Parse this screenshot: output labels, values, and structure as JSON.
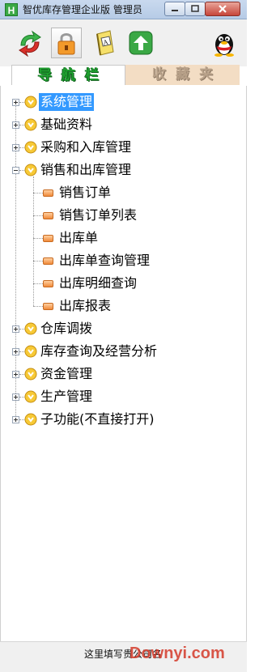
{
  "window": {
    "logo_letter": "H",
    "title": "智优库存管理企业版 管理员"
  },
  "toolbar": {
    "items": [
      {
        "icon": "refresh-arrows-icon"
      },
      {
        "icon": "lock-icon",
        "pressed": true
      },
      {
        "icon": "dictionary-book-icon"
      },
      {
        "icon": "upload-arrow-icon"
      }
    ],
    "right_icon": "qq-penguin-icon"
  },
  "tabs": [
    {
      "label": "导航栏",
      "active": true
    },
    {
      "label": "收藏夹",
      "active": false
    }
  ],
  "tree": {
    "nodes": [
      {
        "label": "系统管理",
        "expanded": false,
        "selected": true
      },
      {
        "label": "基础资料",
        "expanded": false
      },
      {
        "label": "采购和入库管理",
        "expanded": false
      },
      {
        "label": "销售和出库管理",
        "expanded": true,
        "children": [
          "销售订单",
          "销售订单列表",
          "出库单",
          "出库单查询管理",
          "出库明细查询",
          "出库报表"
        ]
      },
      {
        "label": "仓库调拨",
        "expanded": false
      },
      {
        "label": "库存查询及经营分析",
        "expanded": false
      },
      {
        "label": "资金管理",
        "expanded": false
      },
      {
        "label": "生产管理",
        "expanded": false
      },
      {
        "label": "子功能(不直接打开)",
        "expanded": false
      }
    ]
  },
  "status": {
    "text": "这里填写贵公司名"
  },
  "watermark": "Downyi.com",
  "colors": {
    "selected_bg": "#3399ff",
    "active_tab_text": "#20a030",
    "inactive_tab_bg": "#f3ddc4"
  }
}
